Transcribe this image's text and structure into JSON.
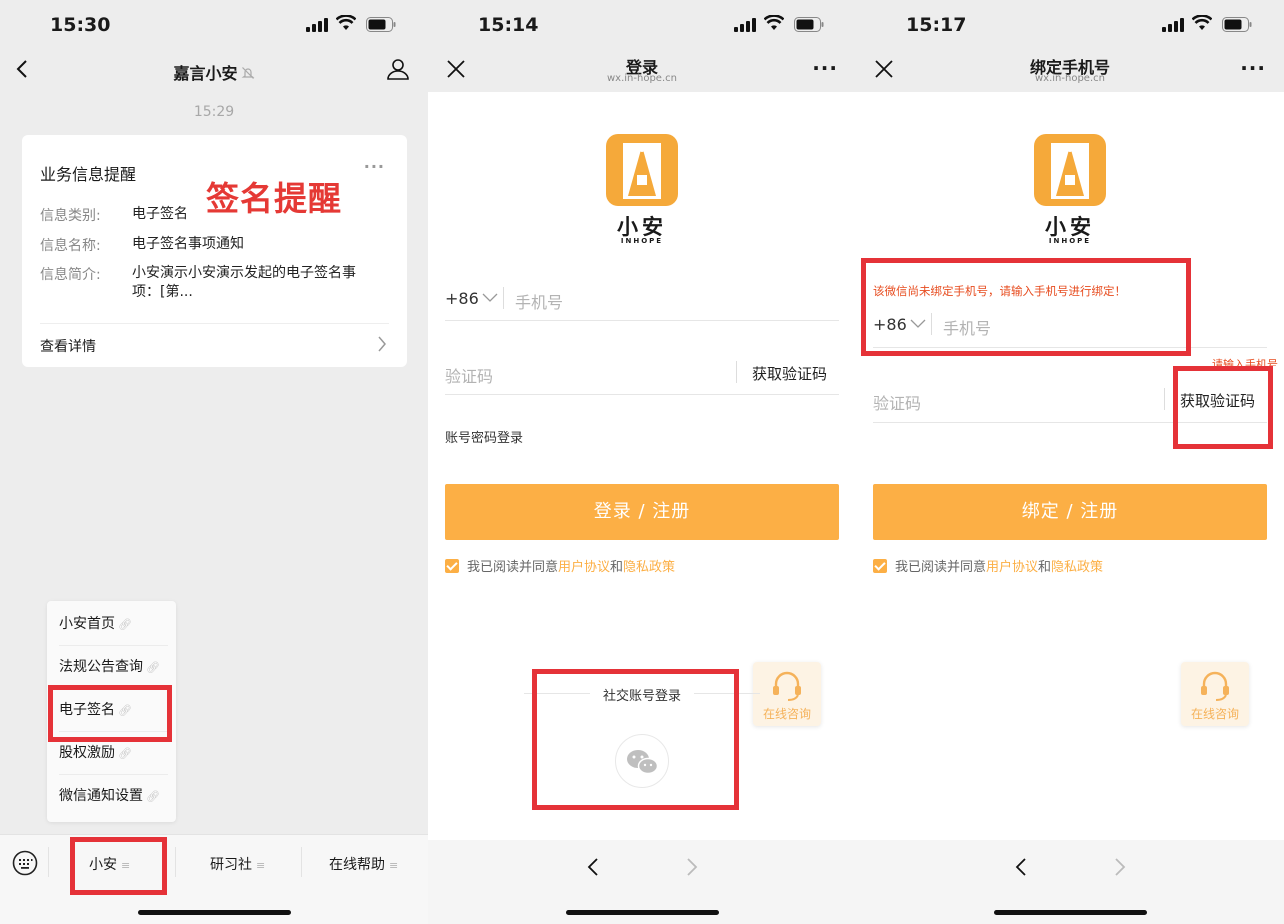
{
  "colors": {
    "accent": "#fcaf45",
    "annotation": "#e53238",
    "warning": "#e74c1f"
  },
  "panel1": {
    "status_time": "15:30",
    "title": "嘉言小安",
    "chat_time": "15:29",
    "card": {
      "title": "业务信息提醒",
      "rows": [
        {
          "key": "信息类别:",
          "value": "电子签名"
        },
        {
          "key": "信息名称:",
          "value": "电子签名事项通知"
        },
        {
          "key": "信息简介:",
          "value": "小安演示小安演示发起的电子签名事项：[第..."
        }
      ],
      "detail": "查看详情"
    },
    "annotation": "签名提醒",
    "menu": [
      "小安首页",
      "法规公告查询",
      "电子签名",
      "股权激励",
      "微信通知设置"
    ],
    "tabs": [
      "小安",
      "研习社",
      "在线帮助"
    ]
  },
  "panel2": {
    "status_time": "15:14",
    "title": "登录",
    "subtitle": "wx.in-hope.cn",
    "brand": "小安",
    "brand_sub": "INHOPE",
    "prefix": "+86",
    "phone_placeholder": "手机号",
    "code_placeholder": "验证码",
    "get_code": "获取验证码",
    "alt_login": "账号密码登录",
    "button": "登录 / 注册",
    "agree_text": "我已阅读并同意",
    "agree_link1": "用户协议",
    "agree_and": "和",
    "agree_link2": "隐私政策",
    "help": "在线咨询",
    "social_title": "社交账号登录"
  },
  "panel3": {
    "status_time": "15:17",
    "title": "绑定手机号",
    "subtitle": "wx.in-hope.cn",
    "brand": "小安",
    "brand_sub": "INHOPE",
    "warning": "该微信尚未绑定手机号，请输入手机号进行绑定！",
    "prefix": "+86",
    "phone_placeholder": "手机号",
    "warning2": "请输入手机号",
    "code_placeholder": "验证码",
    "get_code": "获取验证码",
    "button": "绑定 / 注册",
    "agree_text": "我已阅读并同意",
    "agree_link1": "用户协议",
    "agree_and": "和",
    "agree_link2": "隐私政策",
    "help": "在线咨询"
  }
}
